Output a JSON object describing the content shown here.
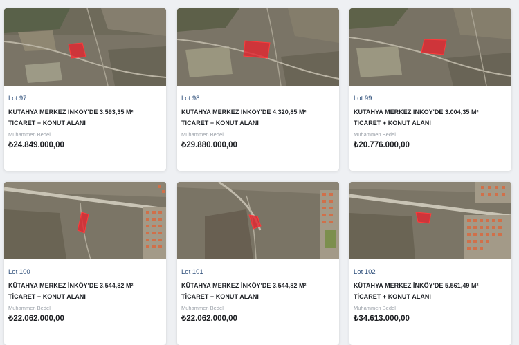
{
  "lots": [
    {
      "lot": "Lot 97",
      "title": "KÜTAHYA MERKEZ İNKÖY'DE 3.593,35 M² TİCARET + KONUT ALANI",
      "price_label": "Muhammen Bedel",
      "price": "₺24.849.000,00",
      "map": "map-a"
    },
    {
      "lot": "Lot 98",
      "title": "KÜTAHYA MERKEZ İNKÖY'DE 4.320,85 M² TİCARET + KONUT ALANI",
      "price_label": "Muhammen Bedel",
      "price": "₺29.880.000,00",
      "map": "map-a"
    },
    {
      "lot": "Lot 99",
      "title": "KÜTAHYA MERKEZ İNKÖY'DE 3.004,35 M² TİCARET + KONUT ALANI",
      "price_label": "Muhammen Bedel",
      "price": "₺20.776.000,00",
      "map": "map-a"
    },
    {
      "lot": "Lot 100",
      "title": "KÜTAHYA MERKEZ İNKÖY'DE 3.544,82 M² TİCARET + KONUT ALANI",
      "price_label": "Muhammen Bedel",
      "price": "₺22.062.000,00",
      "map": "map-b"
    },
    {
      "lot": "Lot 101",
      "title": "KÜTAHYA MERKEZ İNKÖY'DE 3.544,82 M² TİCARET + KONUT ALANI",
      "price_label": "Muhammen Bedel",
      "price": "₺22.062.000,00",
      "map": "map-b"
    },
    {
      "lot": "Lot 102",
      "title": "KÜTAHYA MERKEZ İNKÖY'DE 5.561,49 M² TİCARET + KONUT ALANI",
      "price_label": "Muhammen Bedel",
      "price": "₺34.613.000,00",
      "map": "map-b"
    }
  ],
  "colors": {
    "lot_link": "#2c4d79",
    "parcel_fill": "#e3262f",
    "terrain": "#6f6a5e",
    "page_bg": "#eef0f3"
  }
}
